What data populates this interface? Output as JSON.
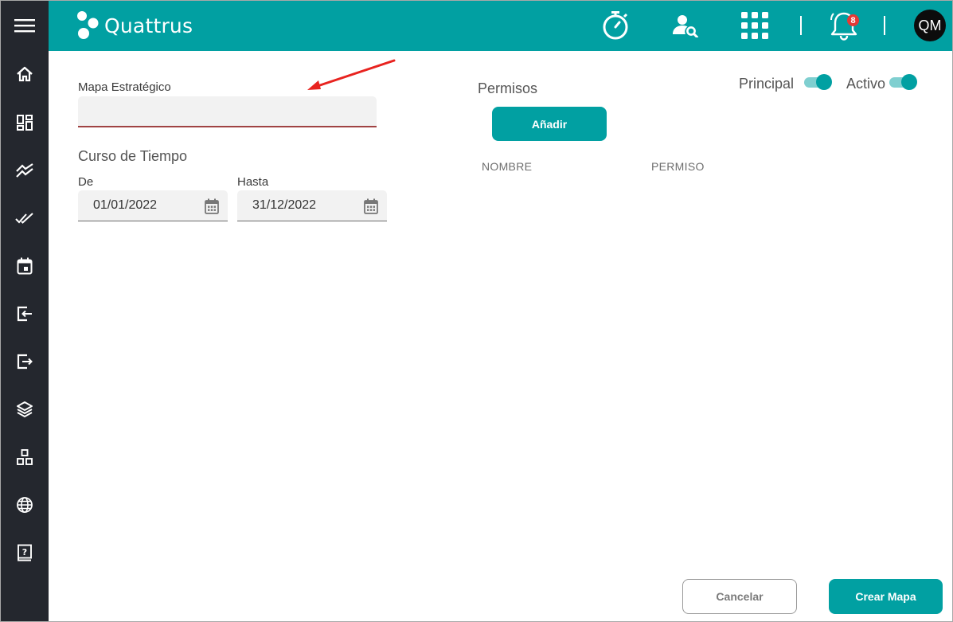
{
  "app": {
    "brand": "Quattrus"
  },
  "topbar": {
    "notifications_count": "8",
    "avatar_initials": "QM"
  },
  "sidebar": {
    "icons": [
      "menu-icon",
      "home-icon",
      "dashboard-icon",
      "trend-icon",
      "double-check-icon",
      "calendar-icon",
      "login-icon",
      "logout-icon",
      "layers-icon",
      "org-chart-icon",
      "globe-icon",
      "help-book-icon"
    ]
  },
  "form": {
    "map_label": "Mapa Estratégico",
    "map_value": "",
    "time_section_title": "Curso de Tiempo",
    "from_label": "De",
    "from_value": "01/01/2022",
    "to_label": "Hasta",
    "to_value": "31/12/2022"
  },
  "permissions": {
    "title": "Permisos",
    "add_button": "Añadir",
    "columns": [
      "NOMBRE",
      "PERMISO"
    ],
    "rows": []
  },
  "toggles": {
    "principal_label": "Principal",
    "principal_on": true,
    "activo_label": "Activo",
    "activo_on": true
  },
  "footer": {
    "cancel_button": "Cancelar",
    "create_button": "Crear Mapa"
  },
  "colors": {
    "accent": "#01a0a2",
    "sidebar": "#24272e",
    "error_underline": "#a04343",
    "annotation_arrow": "#e8231f"
  }
}
